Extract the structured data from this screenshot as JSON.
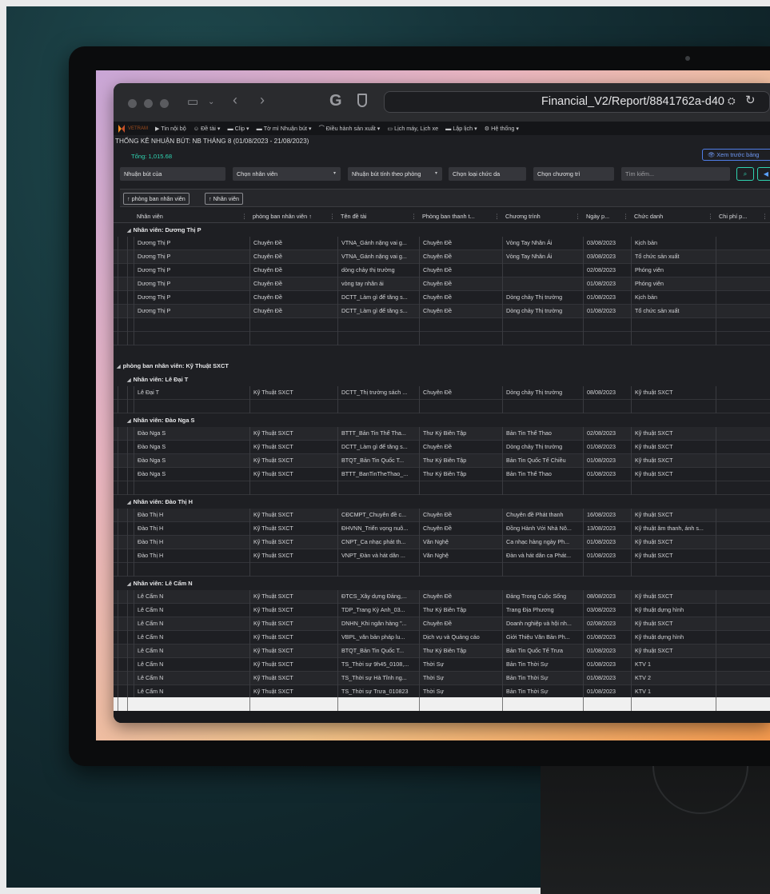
{
  "browser": {
    "url": "Financial_V2/Report/8841762a-d40"
  },
  "nav": {
    "logo": "VETRAM",
    "items": [
      "Tin nội bộ",
      "Đề tài",
      "Clip",
      "Tờ mì Nhuận bút",
      "Điều hành sản xuất",
      "Lịch máy, Lịch xe",
      "Lập lịch",
      "Hệ thống"
    ]
  },
  "report": {
    "title": "THỐNG KÊ NHUẬN BÚT: NB THÁNG 8 (01/08/2023 - 21/08/2023)",
    "total": "Tổng: 1,015.68",
    "preview_button": "Xem trước bảng"
  },
  "filters": {
    "nhuan_but_cua": "Nhuận bút của",
    "chon_nhan_vien": "Chọn nhân viên",
    "tinh_theo_phong": "Nhuận bút tính theo phòng",
    "loai_chuc_danh": "Chọn loại chức da",
    "chuong_trinh": "Chọn chương trì",
    "search_placeholder": "Tìm kiếm..."
  },
  "group_chips": [
    "↑ phòng ban nhân viên",
    "↑ Nhân viên"
  ],
  "columns": [
    "Nhân viên",
    "phòng ban nhân viên ↑",
    "Tên đề tài",
    "Phòng ban thanh t...",
    "Chương trình",
    "Ngày p...",
    "Chức danh",
    "Chi phí p..."
  ],
  "rows": [
    {
      "type": "emp",
      "label": "Nhân viên: Dương Thị P"
    },
    {
      "type": "data",
      "cells": [
        "Dương Thị P",
        "Chuyên Đề",
        "VTNA_Gánh nặng vai g...",
        "Chuyên Đề",
        "Vòng Tay Nhân Ái",
        "03/08/2023",
        "Kịch bản",
        ""
      ]
    },
    {
      "type": "data",
      "cells": [
        "Dương Thị P",
        "Chuyên Đề",
        "VTNA_Gánh nặng vai g...",
        "Chuyên Đề",
        "Vòng Tay Nhân Ái",
        "03/08/2023",
        "Tổ chức sản xuất",
        ""
      ]
    },
    {
      "type": "data",
      "cells": [
        "Dương Thị P",
        "Chuyên Đề",
        "dòng chảy thị trường",
        "Chuyên Đề",
        "",
        "02/08/2023",
        "Phóng viên",
        ""
      ]
    },
    {
      "type": "data",
      "cells": [
        "Dương Thị P",
        "Chuyên Đề",
        "vòng tay nhân ái",
        "Chuyên Đề",
        "",
        "01/08/2023",
        "Phóng viên",
        ""
      ]
    },
    {
      "type": "data",
      "cells": [
        "Dương Thị P",
        "Chuyên Đề",
        "DCTT_Làm gì để tăng s...",
        "Chuyên Đề",
        "Dòng chảy Thị trường",
        "01/08/2023",
        "Kịch bản",
        ""
      ]
    },
    {
      "type": "data",
      "cells": [
        "Dương Thị P",
        "Chuyên Đề",
        "DCTT_Làm gì để tăng s...",
        "Chuyên Đề",
        "Dòng chảy Thị trường",
        "01/08/2023",
        "Tổ chức sản xuất",
        ""
      ]
    },
    {
      "type": "blank"
    },
    {
      "type": "blank"
    },
    {
      "type": "space"
    },
    {
      "type": "dept",
      "label": "phòng ban nhân viên: Kỹ Thuật SXCT"
    },
    {
      "type": "emp",
      "label": "Nhân viên: Lê Đại T"
    },
    {
      "type": "data",
      "cells": [
        "Lê Đại T",
        "Kỹ Thuật SXCT",
        "DCTT_Thị trường sách ...",
        "Chuyên Đề",
        "Dòng chảy Thị trường",
        "08/08/2023",
        "Kỹ thuật SXCT",
        ""
      ]
    },
    {
      "type": "blank"
    },
    {
      "type": "emp",
      "label": "Nhân viên: Đào Nga S"
    },
    {
      "type": "data",
      "cells": [
        "Đào Nga S",
        "Kỹ Thuật SXCT",
        "BTTT_Bản Tin Thể Tha...",
        "Thư Ký Biên Tập",
        "Bản Tin Thể Thao",
        "02/08/2023",
        "Kỹ thuật SXCT",
        ""
      ]
    },
    {
      "type": "data",
      "cells": [
        "Đào Nga S",
        "Kỹ Thuật SXCT",
        "DCTT_Làm gì để tăng s...",
        "Chuyên Đề",
        "Dòng chảy Thị trường",
        "01/08/2023",
        "Kỹ thuật SXCT",
        ""
      ]
    },
    {
      "type": "data",
      "cells": [
        "Đào Nga S",
        "Kỹ Thuật SXCT",
        "BTQT_Bản Tin Quốc T...",
        "Thư Ký Biên Tập",
        "Bản Tin Quốc Tế Chiều",
        "01/08/2023",
        "Kỹ thuật SXCT",
        ""
      ]
    },
    {
      "type": "data",
      "cells": [
        "Đào Nga S",
        "Kỹ Thuật SXCT",
        "BTTT_BanTinTheThao_...",
        "Thư Ký Biên Tập",
        "Bản Tin Thể Thao",
        "01/08/2023",
        "Kỹ thuật SXCT",
        ""
      ]
    },
    {
      "type": "blank"
    },
    {
      "type": "emp",
      "label": "Nhân viên: Đào Thị H"
    },
    {
      "type": "data",
      "cells": [
        "Đào Thị H",
        "Kỹ Thuật SXCT",
        "CĐCMPT_Chuyên đề c...",
        "Chuyên Đề",
        "Chuyên đề Phát thanh",
        "16/08/2023",
        "Kỹ thuật SXCT",
        ""
      ]
    },
    {
      "type": "data",
      "cells": [
        "Đào Thị H",
        "Kỹ Thuật SXCT",
        "ĐHVNN_Triển vọng nuô...",
        "Chuyên Đề",
        "Đồng Hành Với Nhà Nô...",
        "13/08/2023",
        "Kỹ thuật âm thanh, ánh s...",
        ""
      ]
    },
    {
      "type": "data",
      "cells": [
        "Đào Thị H",
        "Kỹ Thuật SXCT",
        "CNPT_Ca nhạc phát th...",
        "Văn Nghệ",
        "Ca nhạc hàng ngày Ph...",
        "01/08/2023",
        "Kỹ thuật SXCT",
        ""
      ]
    },
    {
      "type": "data",
      "cells": [
        "Đào Thị H",
        "Kỹ Thuật SXCT",
        "VNPT_Đàn và hát dân ...",
        "Văn Nghệ",
        "Đàn và hát dân ca Phát...",
        "01/08/2023",
        "Kỹ thuật SXCT",
        ""
      ]
    },
    {
      "type": "blank"
    },
    {
      "type": "emp",
      "label": "Nhân viên: Lê Cẩm N"
    },
    {
      "type": "data",
      "cells": [
        "Lê Cẩm N",
        "Kỹ Thuật SXCT",
        "ĐTCS_Xây dựng Đảng,...",
        "Chuyên Đề",
        "Đảng Trong Cuộc Sống",
        "08/08/2023",
        "Kỹ thuật SXCT",
        ""
      ]
    },
    {
      "type": "data",
      "cells": [
        "Lê Cẩm N",
        "Kỹ Thuật SXCT",
        "TDP_Trang Kỳ Anh_03...",
        "Thư Ký Biên Tập",
        "Trang Địa Phương",
        "03/08/2023",
        "Kỹ thuật dựng hình",
        ""
      ]
    },
    {
      "type": "data",
      "cells": [
        "Lê Cẩm N",
        "Kỹ Thuật SXCT",
        "DNHN_Khi ngân hàng \"...",
        "Chuyên Đề",
        "Doanh nghiệp và hội nh...",
        "02/08/2023",
        "Kỹ thuật SXCT",
        ""
      ]
    },
    {
      "type": "data",
      "cells": [
        "Lê Cẩm N",
        "Kỹ Thuật SXCT",
        "VBPL_văn bản pháp lu...",
        "Dịch vụ và Quảng cáo",
        "Giới Thiệu Văn Bản Ph...",
        "01/08/2023",
        "Kỹ thuật dựng hình",
        ""
      ]
    },
    {
      "type": "data",
      "cells": [
        "Lê Cẩm N",
        "Kỹ Thuật SXCT",
        "BTQT_Bản Tin Quốc T...",
        "Thư Ký Biên Tập",
        "Bản Tin Quốc Tế Trưa",
        "01/08/2023",
        "Kỹ thuật SXCT",
        ""
      ]
    },
    {
      "type": "data",
      "cells": [
        "Lê Cẩm N",
        "Kỹ Thuật SXCT",
        "TS_Thời sự 9h45_0108,...",
        "Thời Sự",
        "Bản Tin Thời Sự",
        "01/08/2023",
        "KTV 1",
        ""
      ]
    },
    {
      "type": "data",
      "cells": [
        "Lê Cẩm N",
        "Kỹ Thuật SXCT",
        "TS_Thời sự Hà Tĩnh ng...",
        "Thời Sự",
        "Bản Tin Thời Sự",
        "01/08/2023",
        "KTV 2",
        ""
      ]
    },
    {
      "type": "data",
      "cells": [
        "Lê Cẩm N",
        "Kỹ Thuật SXCT",
        "TS_Thời sự Trưa_010823",
        "Thời Sự",
        "Bản Tin Thời Sự",
        "01/08/2023",
        "KTV 1",
        ""
      ]
    }
  ]
}
